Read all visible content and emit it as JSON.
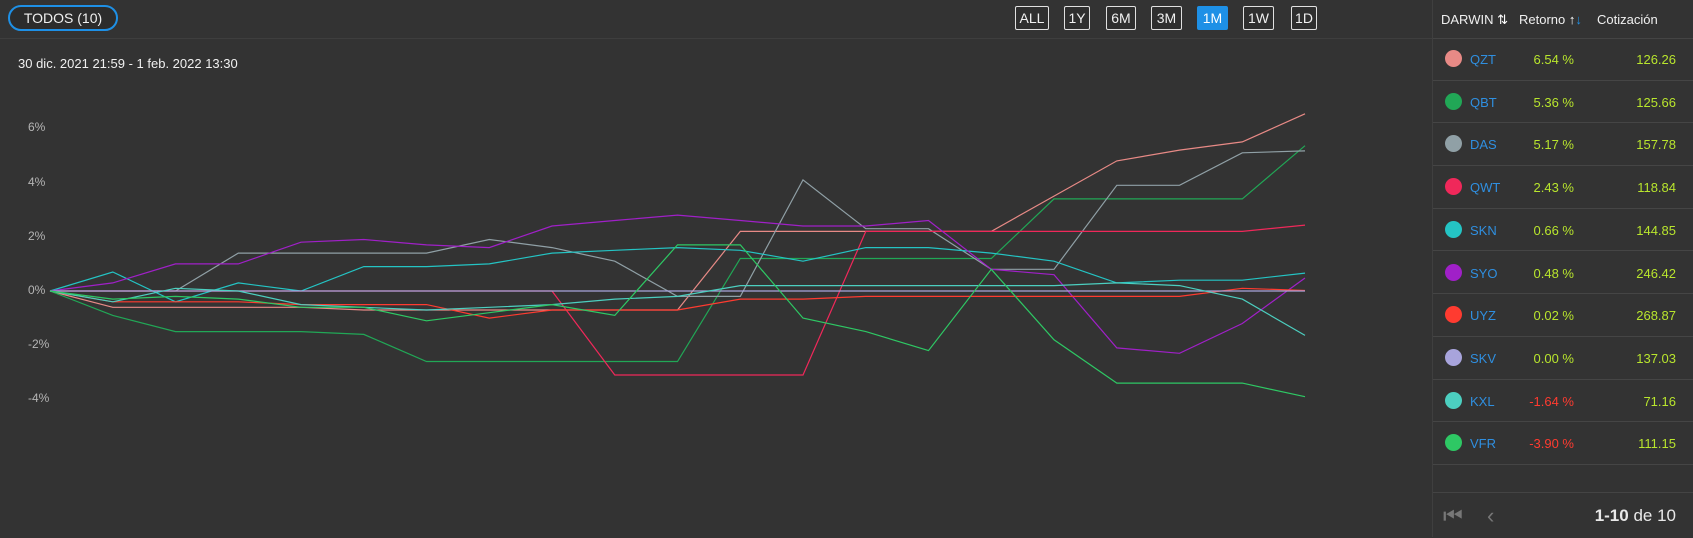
{
  "filter_label": "TODOS (10)",
  "timeframes": [
    {
      "label": "ALL",
      "active": false
    },
    {
      "label": "1Y",
      "active": false
    },
    {
      "label": "6M",
      "active": false
    },
    {
      "label": "3M",
      "active": false
    },
    {
      "label": "1M",
      "active": true
    },
    {
      "label": "1W",
      "active": false
    },
    {
      "label": "1D",
      "active": false
    }
  ],
  "date_range": "30 dic. 2021 21:59 - 1 feb. 2022 13:30",
  "table": {
    "headers": {
      "darwin": "DARWIN",
      "retorno": "Retorno",
      "cotizacion": "Cotización"
    },
    "rows": [
      {
        "symbol": "QZT",
        "retorno": "6.54 %",
        "cotizacion": "126.26",
        "color": "#e88a86",
        "positive": true
      },
      {
        "symbol": "QBT",
        "retorno": "5.36 %",
        "cotizacion": "125.66",
        "color": "#21a756",
        "positive": true
      },
      {
        "symbol": "DAS",
        "retorno": "5.17 %",
        "cotizacion": "157.78",
        "color": "#90a0a6",
        "positive": true
      },
      {
        "symbol": "QWT",
        "retorno": "2.43 %",
        "cotizacion": "118.84",
        "color": "#f0285a",
        "positive": true
      },
      {
        "symbol": "SKN",
        "retorno": "0.66 %",
        "cotizacion": "144.85",
        "color": "#24c4c4",
        "positive": true
      },
      {
        "symbol": "SYO",
        "retorno": "0.48 %",
        "cotizacion": "246.42",
        "color": "#a020c8",
        "positive": true
      },
      {
        "symbol": "UYZ",
        "retorno": "0.02 %",
        "cotizacion": "268.87",
        "color": "#ff3b30",
        "positive": true
      },
      {
        "symbol": "SKV",
        "retorno": "0.00 %",
        "cotizacion": "137.03",
        "color": "#a8a4dc",
        "positive": true
      },
      {
        "symbol": "KXL",
        "retorno": "-1.64 %",
        "cotizacion": "71.16",
        "color": "#4ccfc0",
        "positive": false
      },
      {
        "symbol": "VFR",
        "retorno": "-3.90 %",
        "cotizacion": "111.15",
        "color": "#2ec864",
        "positive": false
      }
    ]
  },
  "pagination": {
    "range": "1-10",
    "of_text": "de 10"
  },
  "chart_data": {
    "type": "line",
    "x": [
      0,
      5,
      10,
      15,
      20,
      25,
      30,
      35,
      40,
      45,
      50,
      55,
      60,
      65,
      70,
      75,
      80,
      85,
      90,
      95,
      100
    ],
    "yticks": [
      "6%",
      "4%",
      "2%",
      "0%",
      "-2%",
      "-4%"
    ],
    "ylim": [
      -5,
      8
    ],
    "zero_line": true,
    "series": [
      {
        "name": "QZT",
        "color": "#e88a86",
        "values": [
          0,
          -0.6,
          -0.6,
          -0.6,
          -0.6,
          -0.7,
          -0.7,
          -0.7,
          -0.7,
          -0.7,
          -0.7,
          2.2,
          2.2,
          2.2,
          2.2,
          2.2,
          3.5,
          4.8,
          5.2,
          5.5,
          6.54
        ]
      },
      {
        "name": "QBT",
        "color": "#21a756",
        "values": [
          0,
          -0.9,
          -1.5,
          -1.5,
          -1.5,
          -1.6,
          -2.6,
          -2.6,
          -2.6,
          -2.6,
          -2.6,
          1.2,
          1.2,
          1.2,
          1.2,
          1.2,
          3.4,
          3.4,
          3.4,
          3.4,
          5.36
        ]
      },
      {
        "name": "DAS",
        "color": "#90a0a6",
        "values": [
          0,
          0,
          0,
          1.4,
          1.4,
          1.4,
          1.4,
          1.9,
          1.6,
          1.1,
          -0.2,
          -0.2,
          4.1,
          2.3,
          2.3,
          0.8,
          0.8,
          3.9,
          3.9,
          5.1,
          5.17
        ]
      },
      {
        "name": "QWT",
        "color": "#f0285a",
        "values": [
          0,
          0,
          0,
          0,
          0,
          0,
          0,
          0,
          0,
          -3.1,
          -3.1,
          -3.1,
          -3.1,
          2.2,
          2.2,
          2.2,
          2.2,
          2.2,
          2.2,
          2.2,
          2.43
        ]
      },
      {
        "name": "SKN",
        "color": "#24c4c4",
        "values": [
          0,
          0.7,
          -0.4,
          0.3,
          0,
          0.9,
          0.9,
          1.0,
          1.4,
          1.5,
          1.6,
          1.5,
          1.1,
          1.6,
          1.6,
          1.4,
          1.1,
          0.3,
          0.4,
          0.4,
          0.66
        ]
      },
      {
        "name": "SYO",
        "color": "#a020c8",
        "values": [
          0,
          0.3,
          1.0,
          1.0,
          1.8,
          1.9,
          1.7,
          1.6,
          2.4,
          2.6,
          2.8,
          2.6,
          2.4,
          2.4,
          2.6,
          0.8,
          0.6,
          -2.1,
          -2.3,
          -1.2,
          0.48
        ]
      },
      {
        "name": "UYZ",
        "color": "#ff3b30",
        "values": [
          0,
          -0.4,
          -0.4,
          -0.4,
          -0.5,
          -0.5,
          -0.5,
          -1.0,
          -0.7,
          -0.7,
          -0.7,
          -0.3,
          -0.3,
          -0.2,
          -0.2,
          -0.2,
          -0.2,
          -0.2,
          -0.2,
          0.1,
          0.02
        ]
      },
      {
        "name": "SKV",
        "color": "#a8a4dc",
        "values": [
          0,
          0,
          0,
          0,
          0,
          0,
          0,
          0,
          0,
          0,
          0,
          0,
          0,
          0,
          0,
          0,
          0,
          0,
          0,
          0,
          0
        ]
      },
      {
        "name": "KXL",
        "color": "#4ccfc0",
        "values": [
          0,
          -0.4,
          0.1,
          0,
          -0.5,
          -0.6,
          -0.7,
          -0.6,
          -0.5,
          -0.3,
          -0.2,
          0.2,
          0.2,
          0.2,
          0.2,
          0.2,
          0.2,
          0.3,
          0.2,
          -0.3,
          -1.64
        ]
      },
      {
        "name": "VFR",
        "color": "#2ec864",
        "values": [
          0,
          -0.3,
          -0.2,
          -0.3,
          -0.6,
          -0.6,
          -1.1,
          -0.8,
          -0.5,
          -0.9,
          1.7,
          1.7,
          -1.0,
          -1.5,
          -2.2,
          0.8,
          -1.8,
          -3.4,
          -3.4,
          -3.4,
          -3.9
        ]
      }
    ]
  }
}
